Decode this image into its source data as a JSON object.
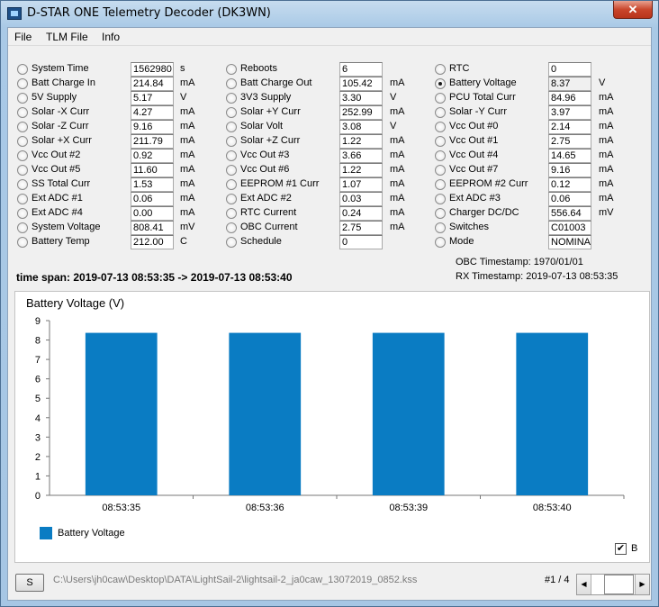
{
  "window": {
    "title": "D-STAR ONE Telemetry Decoder (DK3WN)",
    "close_label": "✕"
  },
  "menu": [
    "File",
    "TLM File",
    "Info"
  ],
  "columns": [
    [
      {
        "label": "System Time",
        "value": "1562980",
        "unit": "s",
        "checked": false
      },
      {
        "label": "Batt Charge In",
        "value": "214.84",
        "unit": "mA",
        "checked": false
      },
      {
        "label": "5V Supply",
        "value": "5.17",
        "unit": "V",
        "checked": false
      },
      {
        "label": "Solar -X Curr",
        "value": "4.27",
        "unit": "mA",
        "checked": false
      },
      {
        "label": "Solar -Z Curr",
        "value": "9.16",
        "unit": "mA",
        "checked": false
      },
      {
        "label": "Solar +X Curr",
        "value": "211.79",
        "unit": "mA",
        "checked": false
      },
      {
        "label": "Vcc Out #2",
        "value": "0.92",
        "unit": "mA",
        "checked": false
      },
      {
        "label": "Vcc Out #5",
        "value": "11.60",
        "unit": "mA",
        "checked": false
      },
      {
        "label": "SS Total Curr",
        "value": "1.53",
        "unit": "mA",
        "checked": false
      },
      {
        "label": "Ext ADC #1",
        "value": "0.06",
        "unit": "mA",
        "checked": false
      },
      {
        "label": "Ext ADC #4",
        "value": "0.00",
        "unit": "mA",
        "checked": false
      },
      {
        "label": "System Voltage",
        "value": "808.41",
        "unit": "mV",
        "checked": false
      },
      {
        "label": "Battery Temp",
        "value": "212.00",
        "unit": "C",
        "checked": false
      }
    ],
    [
      {
        "label": "Reboots",
        "value": "6",
        "unit": "",
        "checked": false
      },
      {
        "label": "Batt Charge Out",
        "value": "105.42",
        "unit": "mA",
        "checked": false
      },
      {
        "label": "3V3 Supply",
        "value": "3.30",
        "unit": "V",
        "checked": false
      },
      {
        "label": "Solar +Y Curr",
        "value": "252.99",
        "unit": "mA",
        "checked": false
      },
      {
        "label": "Solar Volt",
        "value": "3.08",
        "unit": "V",
        "checked": false
      },
      {
        "label": "Solar +Z Curr",
        "value": "1.22",
        "unit": "mA",
        "checked": false
      },
      {
        "label": "Vcc Out #3",
        "value": "3.66",
        "unit": "mA",
        "checked": false
      },
      {
        "label": "Vcc Out #6",
        "value": "1.22",
        "unit": "mA",
        "checked": false
      },
      {
        "label": "EEPROM #1 Curr",
        "value": "1.07",
        "unit": "mA",
        "checked": false
      },
      {
        "label": "Ext ADC #2",
        "value": "0.03",
        "unit": "mA",
        "checked": false
      },
      {
        "label": "RTC Current",
        "value": "0.24",
        "unit": "mA",
        "checked": false
      },
      {
        "label": "OBC Current",
        "value": "2.75",
        "unit": "mA",
        "checked": false
      },
      {
        "label": "Schedule",
        "value": "0",
        "unit": "",
        "checked": false
      }
    ],
    [
      {
        "label": "RTC",
        "value": "0",
        "unit": "",
        "checked": false
      },
      {
        "label": "Battery Voltage",
        "value": "8.37",
        "unit": "V",
        "checked": true
      },
      {
        "label": "PCU Total Curr",
        "value": "84.96",
        "unit": "mA",
        "checked": false
      },
      {
        "label": "Solar -Y Curr",
        "value": "3.97",
        "unit": "mA",
        "checked": false
      },
      {
        "label": "Vcc Out #0",
        "value": "2.14",
        "unit": "mA",
        "checked": false
      },
      {
        "label": "Vcc Out #1",
        "value": "2.75",
        "unit": "mA",
        "checked": false
      },
      {
        "label": "Vcc Out #4",
        "value": "14.65",
        "unit": "mA",
        "checked": false
      },
      {
        "label": "Vcc Out #7",
        "value": "9.16",
        "unit": "mA",
        "checked": false
      },
      {
        "label": "EEPROM #2 Curr",
        "value": "0.12",
        "unit": "mA",
        "checked": false
      },
      {
        "label": "Ext ADC #3",
        "value": "0.06",
        "unit": "mA",
        "checked": false
      },
      {
        "label": "Charger DC/DC",
        "value": "556.64",
        "unit": "mV",
        "checked": false
      },
      {
        "label": "Switches",
        "value": "C01003",
        "unit": "",
        "checked": false
      },
      {
        "label": "Mode",
        "value": "NOMINA",
        "unit": "",
        "checked": false
      }
    ]
  ],
  "timestamps": {
    "obc": "OBC Timestamp: 1970/01/01",
    "rx": "RX Timestamp: 2019-07-13 08:53:35"
  },
  "timespan": "time span: 2019-07-13 08:53:35 -> 2019-07-13 08:53:40",
  "chart_data": {
    "type": "bar",
    "title": "Battery Voltage (V)",
    "categories": [
      "08:53:35",
      "08:53:36",
      "08:53:39",
      "08:53:40"
    ],
    "series": [
      {
        "name": "Battery Voltage",
        "values": [
          8.37,
          8.37,
          8.37,
          8.37
        ]
      }
    ],
    "ylim": [
      0,
      9
    ],
    "yticks": [
      0,
      1,
      2,
      3,
      4,
      5,
      6,
      7,
      8,
      9
    ],
    "grid": false,
    "legend": "bottom-left",
    "color": "#0a7cc3"
  },
  "chart_checkbox": {
    "label": "B",
    "checked": true
  },
  "footer": {
    "s_button": "S",
    "file_path": "C:\\Users\\jh0caw\\Desktop\\DATA\\LightSail-2\\lightsail-2_ja0caw_13072019_0852.kss",
    "page": "#1 / 4"
  }
}
